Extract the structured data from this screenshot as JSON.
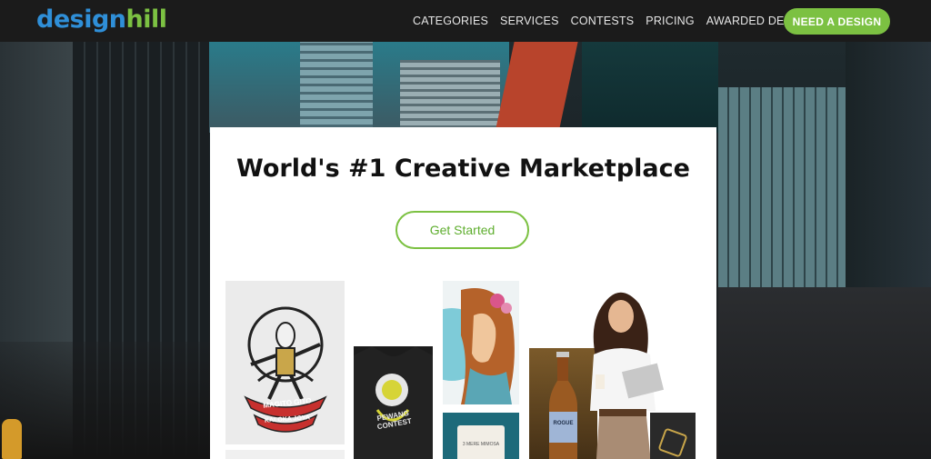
{
  "brand": {
    "logo_part1": "design",
    "logo_part2": "hill",
    "primary": "#2f8fd8",
    "accent": "#7cc142"
  },
  "nav": {
    "links": [
      "CATEGORIES",
      "SERVICES",
      "CONTESTS",
      "PRICING",
      "AWARDED DESIGNS"
    ],
    "cta_label": "NEED A DESIGN"
  },
  "hero": {
    "headline": "World's #1 Creative Marketplace",
    "button_label": "Get Started"
  },
  "gallery": {
    "tshirt_label": "MAGITO GITO",
    "tshirt_label2": "KALOKA JOYA",
    "dark_shirt_label": "PEWANG CONTEST",
    "pouch_label": "3 MERE MIMOSA",
    "bottle_label": "ROGUE"
  }
}
